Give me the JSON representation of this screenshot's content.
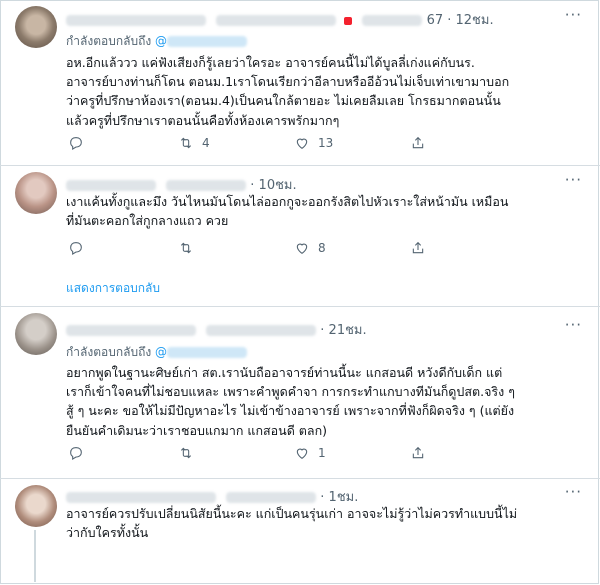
{
  "tweets": [
    {
      "time": "· 12ชม.",
      "count_fragment": "67",
      "replying_label": "กำลังตอบกลับถึง",
      "mention": "@",
      "lines": [
        "อห.อีกแล้ววว แค่ฟังเสียงก็รู้เลยว่าใครอะ อาจารย์คนนี้ไม่ได้บูลลี่เก่งแค่กับนร.",
        "อาจารย์บางท่านก็โดน ตอนม.1เราโดนเรียกว่าอีลาบหรืออีอ้วนไม่เจ็บเท่าเขามาบอก",
        "ว่าครูที่ปรึกษาห้องเรา(ตอนม.4)เป็นคนใกล้ตายอะ ไม่เคยลืมเลย โกรธมากตอนนั้น",
        "แล้วครูที่ปรึกษาเราตอนนั้นคือทั้งห้องเคารพรักมากๆ"
      ],
      "retweets": "4",
      "likes": "13"
    },
    {
      "time": "· 10ชม.",
      "lines": [
        "เงาแค้นทั้งกูและมึง วันไหนมันโดนไล่ออกกูจะออกรังสิตไปหัวเราะใส่หน้ามัน เหมือน",
        "ที่มันตะคอกใส่กูกลางแถว ควย"
      ],
      "retweets": "",
      "likes": "8",
      "show_replies": "แสดงการตอบกลับ"
    },
    {
      "time": "· 21ชม.",
      "replying_label": "กำลังตอบกลับถึง",
      "mention": "@",
      "lines": [
        "อยากพูดในฐานะศิษย์เก่า สต.เรานับถืออาจารย์ท่านนี้นะ แกสอนดี หวังดีกับเด็ก แต่",
        "เราก็เข้าใจคนที่ไม่ชอบแหละ เพราะคำพูดคำจา การกระทำแกบางทีมันก็ดูปสต.จริง ๆ",
        "สู้ ๆ นะคะ ขอให้ไม่มีปัญหาอะไร ไม่เข้าข้างอาจารย์ เพราะจากที่ฟังก็ผิดจริง ๆ (แต่ยัง",
        "ยืนยันคำเดิมนะว่าเราชอบแกมาก แกสอนดี ตลก)"
      ],
      "retweets": "",
      "likes": "1"
    },
    {
      "time": "· 1ชม.",
      "lines": [
        "อาจารย์ควรปรับเปลี่ยนนิสัยนี้นะคะ  แก่เป็นคนรุ่นเก่า อาจจะไม่รู้ว่าไม่ควรทำแบบนี้ไม่",
        "ว่ากับใครทั้งนั้น"
      ]
    }
  ],
  "icons": {
    "reply": "reply-icon",
    "retweet": "retweet-icon",
    "like": "heart-icon",
    "share": "share-icon",
    "more": "more-icon"
  },
  "colors": {
    "link": "#1d9bf0",
    "muted": "#536471",
    "text": "#0f1419"
  }
}
